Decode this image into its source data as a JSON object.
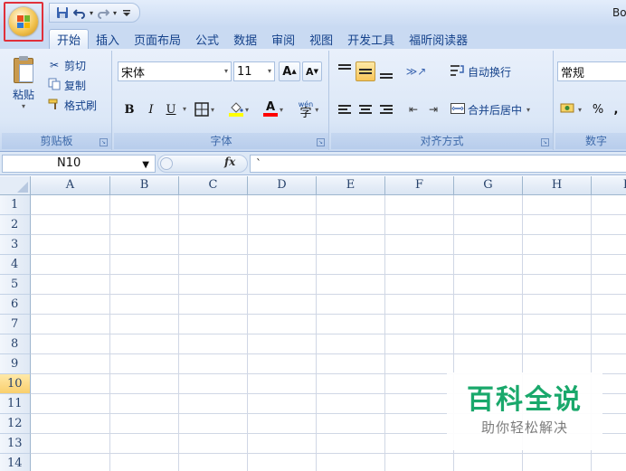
{
  "window": {
    "title": "Bo"
  },
  "quick_access": {
    "items": [
      "save-icon",
      "undo-icon",
      "redo-icon",
      "customize-icon"
    ]
  },
  "ribbon": {
    "tabs": [
      "开始",
      "插入",
      "页面布局",
      "公式",
      "数据",
      "审阅",
      "视图",
      "开发工具",
      "福昕阅读器"
    ],
    "active_tab": "开始",
    "clipboard": {
      "paste": "粘贴",
      "cut": "剪切",
      "copy": "复制",
      "format_painter": "格式刷",
      "label": "剪贴板"
    },
    "font": {
      "name": "宋体",
      "size": "11",
      "grow": "A",
      "shrink": "A",
      "bold": "B",
      "italic": "I",
      "underline": "U",
      "font_color": "A",
      "phonetic": "wén",
      "label": "字体"
    },
    "alignment": {
      "wrap_text": "自动换行",
      "merge_center": "合并后居中",
      "label": "对齐方式"
    },
    "number": {
      "format": "常规",
      "percent": "%",
      "comma": ",",
      "label": "数字"
    },
    "colors": {
      "fill_swatch": "#ffff00",
      "font_swatch": "#ff0000",
      "highlight_border": "#e0303a"
    }
  },
  "formula_bar": {
    "name_box": "N10",
    "fx": "fx",
    "content": "`"
  },
  "sheet": {
    "columns": [
      "A",
      "B",
      "C",
      "D",
      "E",
      "F",
      "G",
      "H",
      "I"
    ],
    "rows": [
      "1",
      "2",
      "3",
      "4",
      "5",
      "6",
      "7",
      "8",
      "9",
      "10",
      "11",
      "12",
      "13",
      "14"
    ],
    "selected_row": "10"
  },
  "watermark": {
    "title": "百科全说",
    "subtitle": "助你轻松解决"
  }
}
